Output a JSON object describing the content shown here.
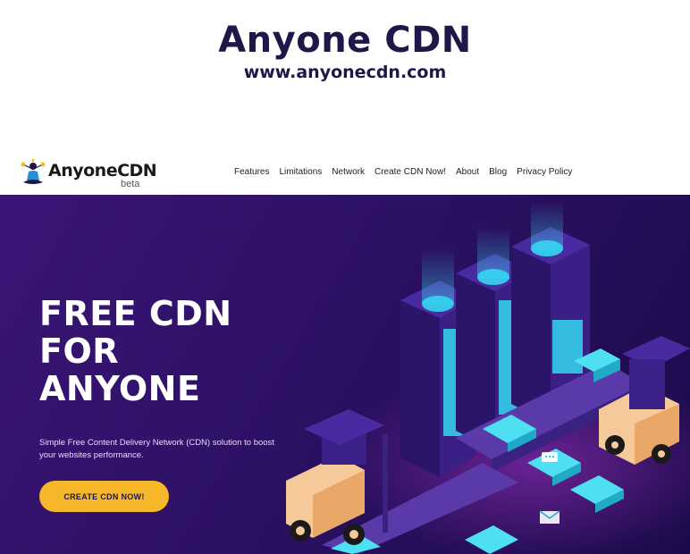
{
  "branding": {
    "title": "Anyone CDN",
    "url": "www.anyonecdn.com"
  },
  "navbar": {
    "logo_text": "AnyoneCDN",
    "logo_badge": "beta",
    "links": [
      "Features",
      "Limitations",
      "Network",
      "Create CDN Now!",
      "About",
      "Blog",
      "Privacy Policy"
    ]
  },
  "hero": {
    "headline": [
      "FREE CDN",
      "FOR",
      "ANYONE"
    ],
    "subtitle": "Simple Free Content Delivery Network (CDN) solution to boost your websites performance.",
    "cta_label": "CREATE CDN NOW!"
  },
  "colors": {
    "hero_bg": "#2d1165",
    "cta": "#f6b72a",
    "brand_text": "#1e1748",
    "server_glow": "#35d6f0"
  },
  "icons": [
    "meditating-person-logo-icon",
    "server-rack-icon",
    "forklift-icon",
    "package-icon",
    "mail-icon",
    "chat-icon"
  ]
}
